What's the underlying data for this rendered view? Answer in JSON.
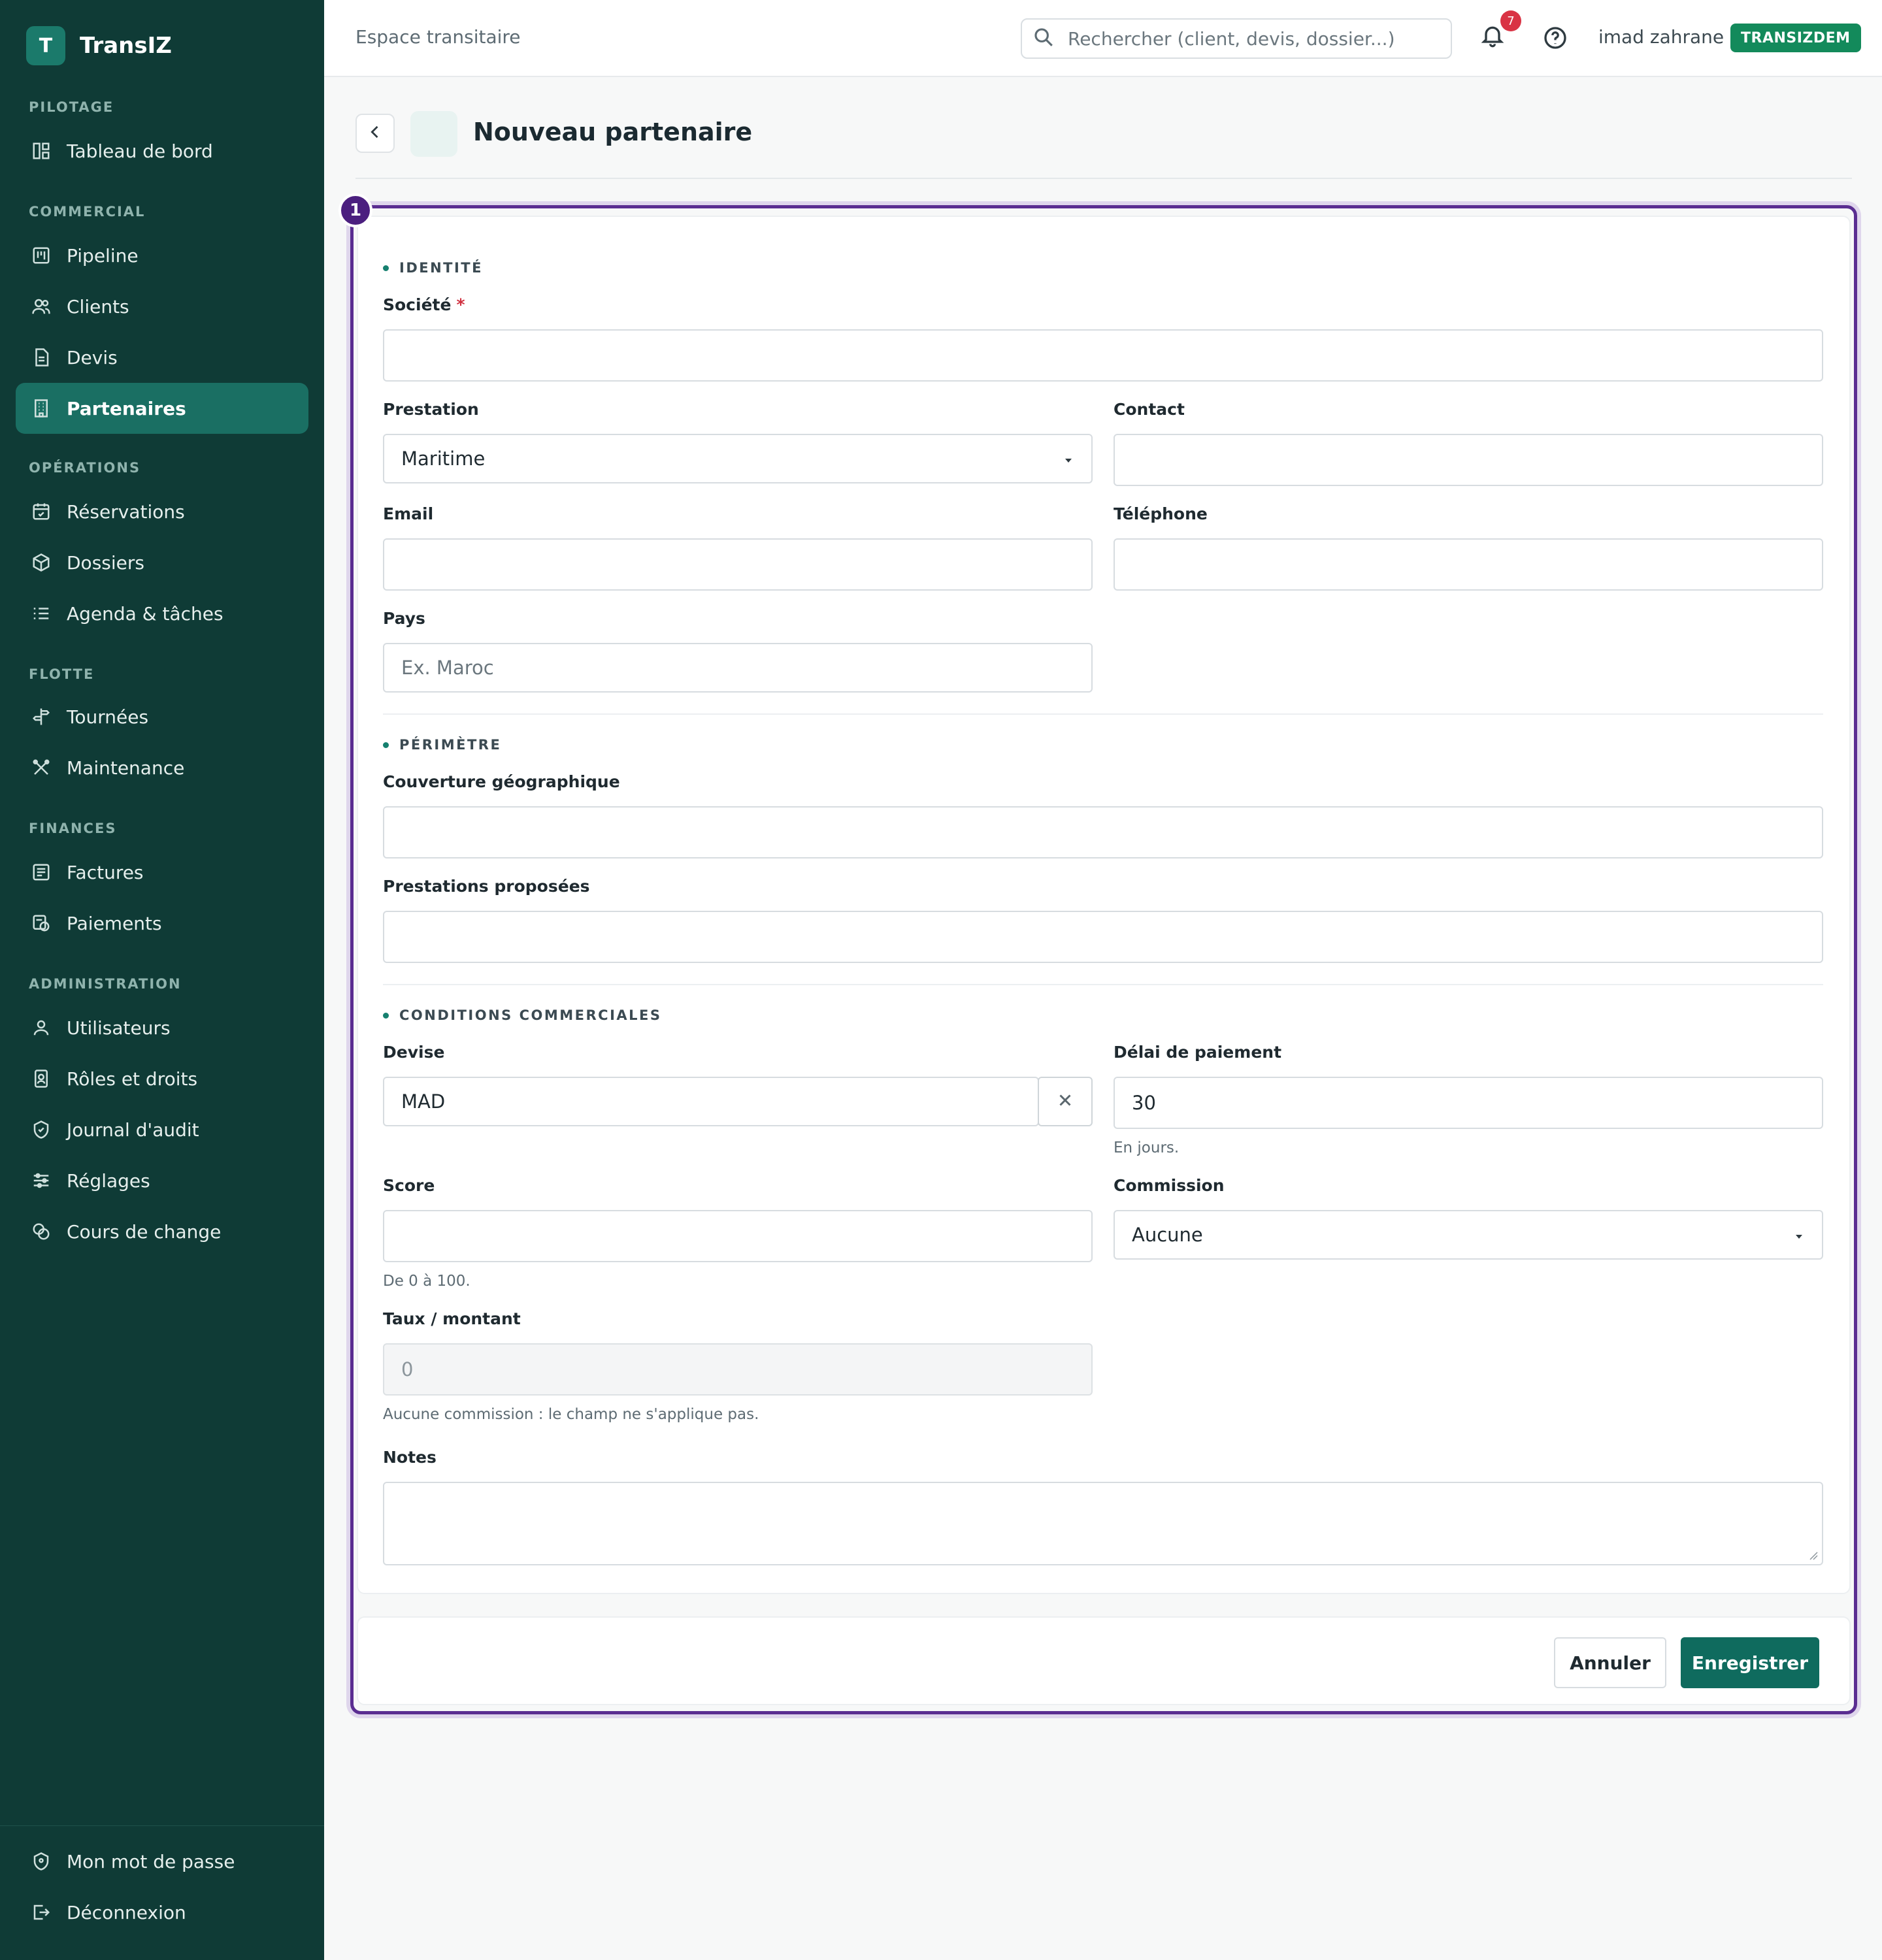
{
  "brand": {
    "logo_letter": "T",
    "name": "TransIZ"
  },
  "nav": {
    "sections": [
      {
        "title": "PILOTAGE",
        "items": [
          {
            "label": "Tableau de bord",
            "icon": "dashboard-icon"
          }
        ]
      },
      {
        "title": "COMMERCIAL",
        "items": [
          {
            "label": "Pipeline",
            "icon": "kanban-icon"
          },
          {
            "label": "Clients",
            "icon": "users-icon"
          },
          {
            "label": "Devis",
            "icon": "document-icon"
          },
          {
            "label": "Partenaires",
            "icon": "building-icon",
            "active": true
          }
        ]
      },
      {
        "title": "OPÉRATIONS",
        "items": [
          {
            "label": "Réservations",
            "icon": "calendar-check-icon"
          },
          {
            "label": "Dossiers",
            "icon": "package-icon"
          },
          {
            "label": "Agenda & tâches",
            "icon": "list-icon"
          }
        ]
      },
      {
        "title": "FLOTTE",
        "items": [
          {
            "label": "Tournées",
            "icon": "signpost-icon"
          },
          {
            "label": "Maintenance",
            "icon": "tools-icon"
          }
        ]
      },
      {
        "title": "FINANCES",
        "items": [
          {
            "label": "Factures",
            "icon": "invoice-icon"
          },
          {
            "label": "Paiements",
            "icon": "payment-icon"
          }
        ]
      },
      {
        "title": "ADMINISTRATION",
        "items": [
          {
            "label": "Utilisateurs",
            "icon": "user-icon"
          },
          {
            "label": "Rôles et droits",
            "icon": "badge-icon"
          },
          {
            "label": "Journal d'audit",
            "icon": "shield-check-icon"
          },
          {
            "label": "Réglages",
            "icon": "sliders-icon"
          },
          {
            "label": "Cours de change",
            "icon": "currency-icon"
          }
        ]
      }
    ],
    "bottom": [
      {
        "label": "Mon mot de passe",
        "icon": "shield-icon"
      },
      {
        "label": "Déconnexion",
        "icon": "logout-icon"
      }
    ]
  },
  "topbar": {
    "workspace": "Espace transitaire",
    "search_placeholder": "Rechercher (client, devis, dossier...)",
    "notifications_count": "7",
    "username": "imad zahrane",
    "org": "TRANSIZDEM"
  },
  "page": {
    "title": "Nouveau partenaire",
    "step": "1"
  },
  "form": {
    "identity": {
      "title": "IDENTITÉ",
      "societe_label": "Société",
      "required_mark": "*",
      "prestation_label": "Prestation",
      "prestation_value": "Maritime",
      "contact_label": "Contact",
      "email_label": "Email",
      "telephone_label": "Téléphone",
      "pays_label": "Pays",
      "pays_placeholder": "Ex. Maroc"
    },
    "perimetre": {
      "title": "PÉRIMÈTRE",
      "couverture_label": "Couverture géographique",
      "prestations_label": "Prestations proposées"
    },
    "conditions": {
      "title": "CONDITIONS COMMERCIALES",
      "devise_label": "Devise",
      "devise_value": "MAD",
      "delai_label": "Délai de paiement",
      "delai_value": "30",
      "delai_help": "En jours.",
      "score_label": "Score",
      "score_help": "De 0 à 100.",
      "commission_label": "Commission",
      "commission_value": "Aucune",
      "taux_label": "Taux / montant",
      "taux_value": "0",
      "taux_help": "Aucune commission : le champ ne s'applique pas.",
      "notes_label": "Notes"
    }
  },
  "actions": {
    "cancel": "Annuler",
    "save": "Enregistrer"
  },
  "colors": {
    "sidebar": "#0f3b36",
    "accent": "#0f6b5e",
    "focus": "#5a2d91",
    "badge": "#138a5b",
    "alert": "#d93344"
  }
}
